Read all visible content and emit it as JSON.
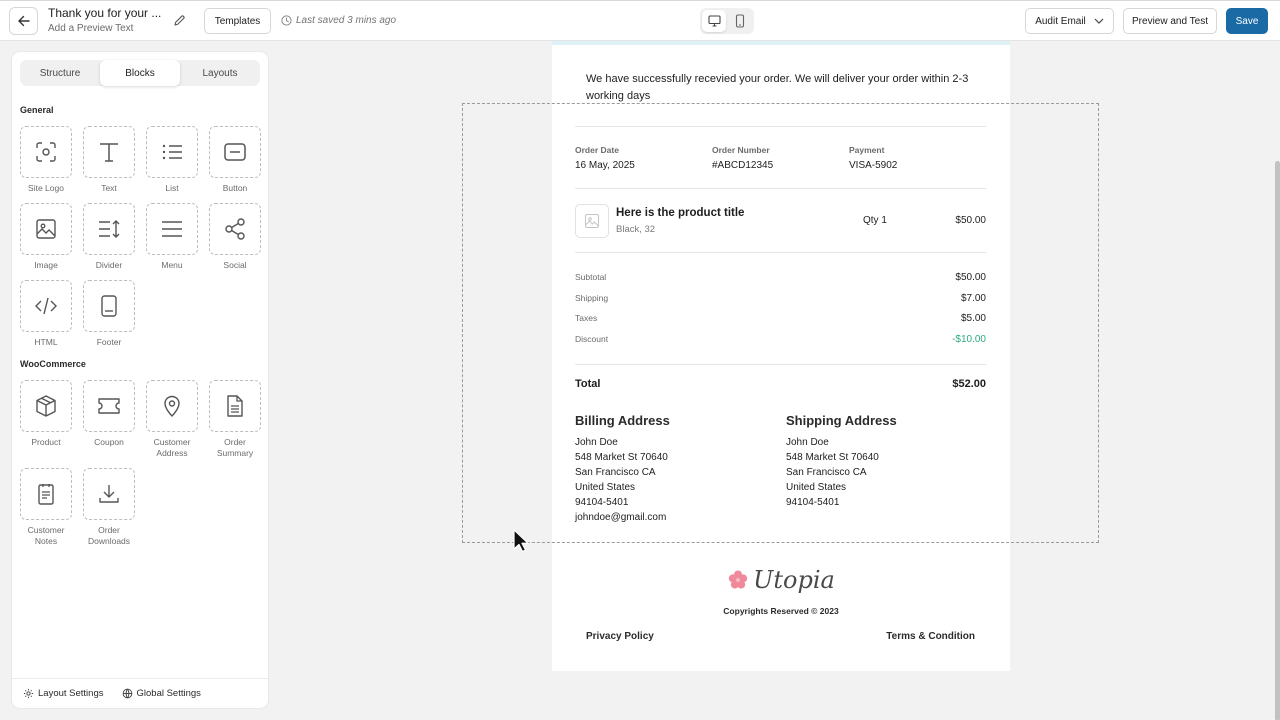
{
  "header": {
    "email_title": "Thank you for your ...",
    "preview_text_placeholder": "Add a Preview Text",
    "templates_label": "Templates",
    "last_saved": "Last saved 3 mins ago",
    "audit_label": "Audit Email",
    "preview_label": "Preview and Test",
    "save_label": "Save",
    "device_options": [
      "desktop",
      "mobile"
    ],
    "device_selected": "desktop",
    "accent_color": "#1a6aa6"
  },
  "sidebar": {
    "tabs": [
      {
        "label": "Structure"
      },
      {
        "label": "Blocks"
      },
      {
        "label": "Layouts"
      }
    ],
    "active_tab": "Blocks",
    "general_label": "General",
    "general_blocks": [
      {
        "label": "Site Logo",
        "icon": "site-logo-icon"
      },
      {
        "label": "Text",
        "icon": "text-icon"
      },
      {
        "label": "List",
        "icon": "list-icon"
      },
      {
        "label": "Button",
        "icon": "button-icon"
      },
      {
        "label": "Image",
        "icon": "image-icon"
      },
      {
        "label": "Divider",
        "icon": "divider-icon"
      },
      {
        "label": "Menu",
        "icon": "menu-icon"
      },
      {
        "label": "Social",
        "icon": "share-icon"
      },
      {
        "label": "HTML",
        "icon": "code-icon"
      },
      {
        "label": "Footer",
        "icon": "footer-icon"
      }
    ],
    "woo_label": "WooCommerce",
    "woo_blocks": [
      {
        "label": "Product",
        "icon": "box-icon"
      },
      {
        "label": "Coupon",
        "icon": "coupon-icon"
      },
      {
        "label": "Customer Address",
        "icon": "map-pin-icon"
      },
      {
        "label": "Order Summary",
        "icon": "document-icon"
      },
      {
        "label": "Customer Notes",
        "icon": "notes-icon"
      },
      {
        "label": "Order Downloads",
        "icon": "download-icon"
      }
    ],
    "footer": {
      "layout_settings": "Layout Settings",
      "global_settings": "Global Settings"
    }
  },
  "email": {
    "intro": "We have successfully recevied your order. We will deliver your order within 2-3 working days",
    "meta": [
      {
        "key": "Order Date",
        "value": "16 May, 2025"
      },
      {
        "key": "Order Number",
        "value": "#ABCD12345"
      },
      {
        "key": "Payment",
        "value": "VISA-5902"
      }
    ],
    "product": {
      "title": "Here is the product title",
      "variant": "Black, 32",
      "qty": "Qty 1",
      "price": "$50.00"
    },
    "summary": [
      {
        "key": "Subtotal",
        "value": "$50.00"
      },
      {
        "key": "Shipping",
        "value": "$7.00"
      },
      {
        "key": "Taxes",
        "value": "$5.00"
      },
      {
        "key": "Discount",
        "value": "-$10.00"
      }
    ],
    "discount_color": "#2eaa7d",
    "total": {
      "key": "Total",
      "value": "$52.00"
    },
    "billing": {
      "heading": "Billing Address",
      "lines": [
        "John Doe",
        "548 Market St 70640",
        "San Francisco CA",
        "United States",
        "94104-5401",
        "johndoe@gmail.com"
      ]
    },
    "shipping": {
      "heading": "Shipping Address",
      "lines": [
        "John Doe",
        "548 Market St 70640",
        "San Francisco CA",
        "United States",
        "94104-5401"
      ]
    },
    "logo_text": "Utopia",
    "logo_color": "#f08a9a",
    "copyright": "Copyrights Reserved © 2023",
    "privacy": "Privacy Policy",
    "terms": "Terms & Condition"
  }
}
